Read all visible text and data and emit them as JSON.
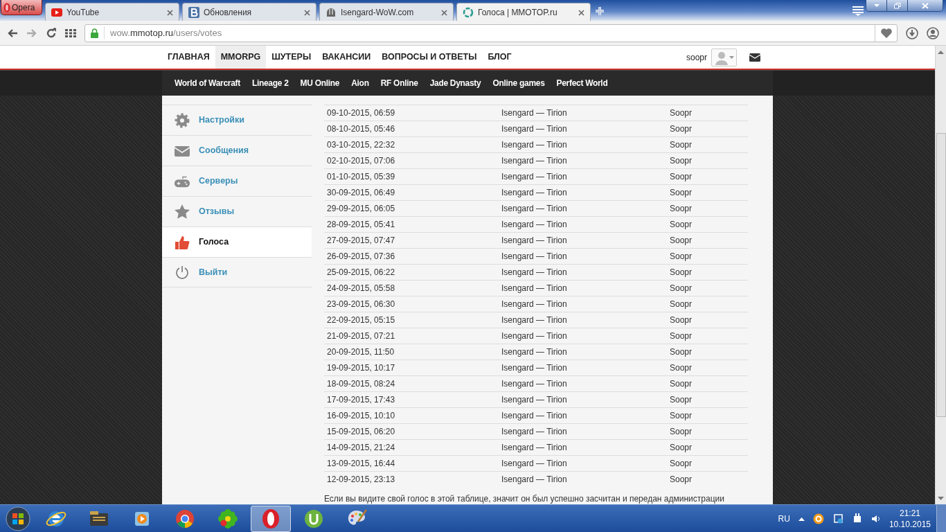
{
  "browser": {
    "menu_label": "Opera",
    "tabs": [
      {
        "title": "YouTube",
        "kind": "play",
        "selected": false
      },
      {
        "title": "Обновления",
        "kind": "letter",
        "selected": false
      },
      {
        "title": "Isengard-WoW.com",
        "kind": "helmet",
        "selected": false
      },
      {
        "title": "Голоса | MMOTOP.ru",
        "kind": "ring",
        "selected": true
      }
    ],
    "address": {
      "prefix": "wow.",
      "domain": "mmotop.ru",
      "path": "/users/votes"
    }
  },
  "site": {
    "nav": [
      {
        "label": "ГЛАВНАЯ",
        "selected": false
      },
      {
        "label": "MMORPG",
        "selected": true
      },
      {
        "label": "ШУТЕРЫ",
        "selected": false
      },
      {
        "label": "ВАКАНСИИ",
        "selected": false
      },
      {
        "label": "ВОПРОСЫ И ОТВЕТЫ",
        "selected": false
      },
      {
        "label": "БЛОГ",
        "selected": false
      }
    ],
    "username": "soopr",
    "subnav": [
      "World of Warcraft",
      "Lineage 2",
      "MU Online",
      "Aion",
      "RF Online",
      "Jade Dynasty",
      "Online games",
      "Perfect World"
    ],
    "sidebar": [
      {
        "label": "Настройки",
        "kind": "gear",
        "selected": false
      },
      {
        "label": "Сообщения",
        "kind": "mail",
        "selected": false
      },
      {
        "label": "Серверы",
        "kind": "gamepad",
        "selected": false
      },
      {
        "label": "Отзывы",
        "kind": "star",
        "selected": false
      },
      {
        "label": "Голоса",
        "kind": "thumb",
        "selected": true
      },
      {
        "label": "Выйти",
        "kind": "power",
        "selected": false
      }
    ],
    "votes": [
      {
        "date": "09-10-2015, 06:59",
        "server": "Isengard — Tirion",
        "user": "Soopr"
      },
      {
        "date": "08-10-2015, 05:46",
        "server": "Isengard — Tirion",
        "user": "Soopr"
      },
      {
        "date": "03-10-2015, 22:32",
        "server": "Isengard — Tirion",
        "user": "Soopr"
      },
      {
        "date": "02-10-2015, 07:06",
        "server": "Isengard — Tirion",
        "user": "Soopr"
      },
      {
        "date": "01-10-2015, 05:39",
        "server": "Isengard — Tirion",
        "user": "Soopr"
      },
      {
        "date": "30-09-2015, 06:49",
        "server": "Isengard — Tirion",
        "user": "Soopr"
      },
      {
        "date": "29-09-2015, 06:05",
        "server": "Isengard — Tirion",
        "user": "Soopr"
      },
      {
        "date": "28-09-2015, 05:41",
        "server": "Isengard — Tirion",
        "user": "Soopr"
      },
      {
        "date": "27-09-2015, 07:47",
        "server": "Isengard — Tirion",
        "user": "Soopr"
      },
      {
        "date": "26-09-2015, 07:36",
        "server": "Isengard — Tirion",
        "user": "Soopr"
      },
      {
        "date": "25-09-2015, 06:22",
        "server": "Isengard — Tirion",
        "user": "Soopr"
      },
      {
        "date": "24-09-2015, 05:58",
        "server": "Isengard — Tirion",
        "user": "Soopr"
      },
      {
        "date": "23-09-2015, 06:30",
        "server": "Isengard — Tirion",
        "user": "Soopr"
      },
      {
        "date": "22-09-2015, 05:15",
        "server": "Isengard — Tirion",
        "user": "Soopr"
      },
      {
        "date": "21-09-2015, 07:21",
        "server": "Isengard — Tirion",
        "user": "Soopr"
      },
      {
        "date": "20-09-2015, 11:50",
        "server": "Isengard — Tirion",
        "user": "Soopr"
      },
      {
        "date": "19-09-2015, 10:17",
        "server": "Isengard — Tirion",
        "user": "Soopr"
      },
      {
        "date": "18-09-2015, 08:24",
        "server": "Isengard — Tirion",
        "user": "Soopr"
      },
      {
        "date": "17-09-2015, 17:43",
        "server": "Isengard — Tirion",
        "user": "Soopr"
      },
      {
        "date": "16-09-2015, 10:10",
        "server": "Isengard — Tirion",
        "user": "Soopr"
      },
      {
        "date": "15-09-2015, 06:20",
        "server": "Isengard — Tirion",
        "user": "Soopr"
      },
      {
        "date": "14-09-2015, 21:24",
        "server": "Isengard — Tirion",
        "user": "Soopr"
      },
      {
        "date": "13-09-2015, 16:44",
        "server": "Isengard — Tirion",
        "user": "Soopr"
      },
      {
        "date": "12-09-2015, 23:13",
        "server": "Isengard — Tirion",
        "user": "Soopr"
      }
    ],
    "note": "Если вы видите свой голос в этой таблице, значит он был успешно засчитан и передан администрации"
  },
  "taskbar": {
    "apps": [
      {
        "kind": "ie",
        "selected": false
      },
      {
        "kind": "folder",
        "selected": false
      },
      {
        "kind": "media",
        "selected": false
      },
      {
        "kind": "chrome",
        "selected": false
      },
      {
        "kind": "flower",
        "selected": false
      },
      {
        "kind": "opera",
        "selected": true
      },
      {
        "kind": "torrent",
        "selected": false
      },
      {
        "kind": "paint",
        "selected": false
      }
    ],
    "language": "RU",
    "time": "21:21",
    "date": "10.10.2015"
  }
}
